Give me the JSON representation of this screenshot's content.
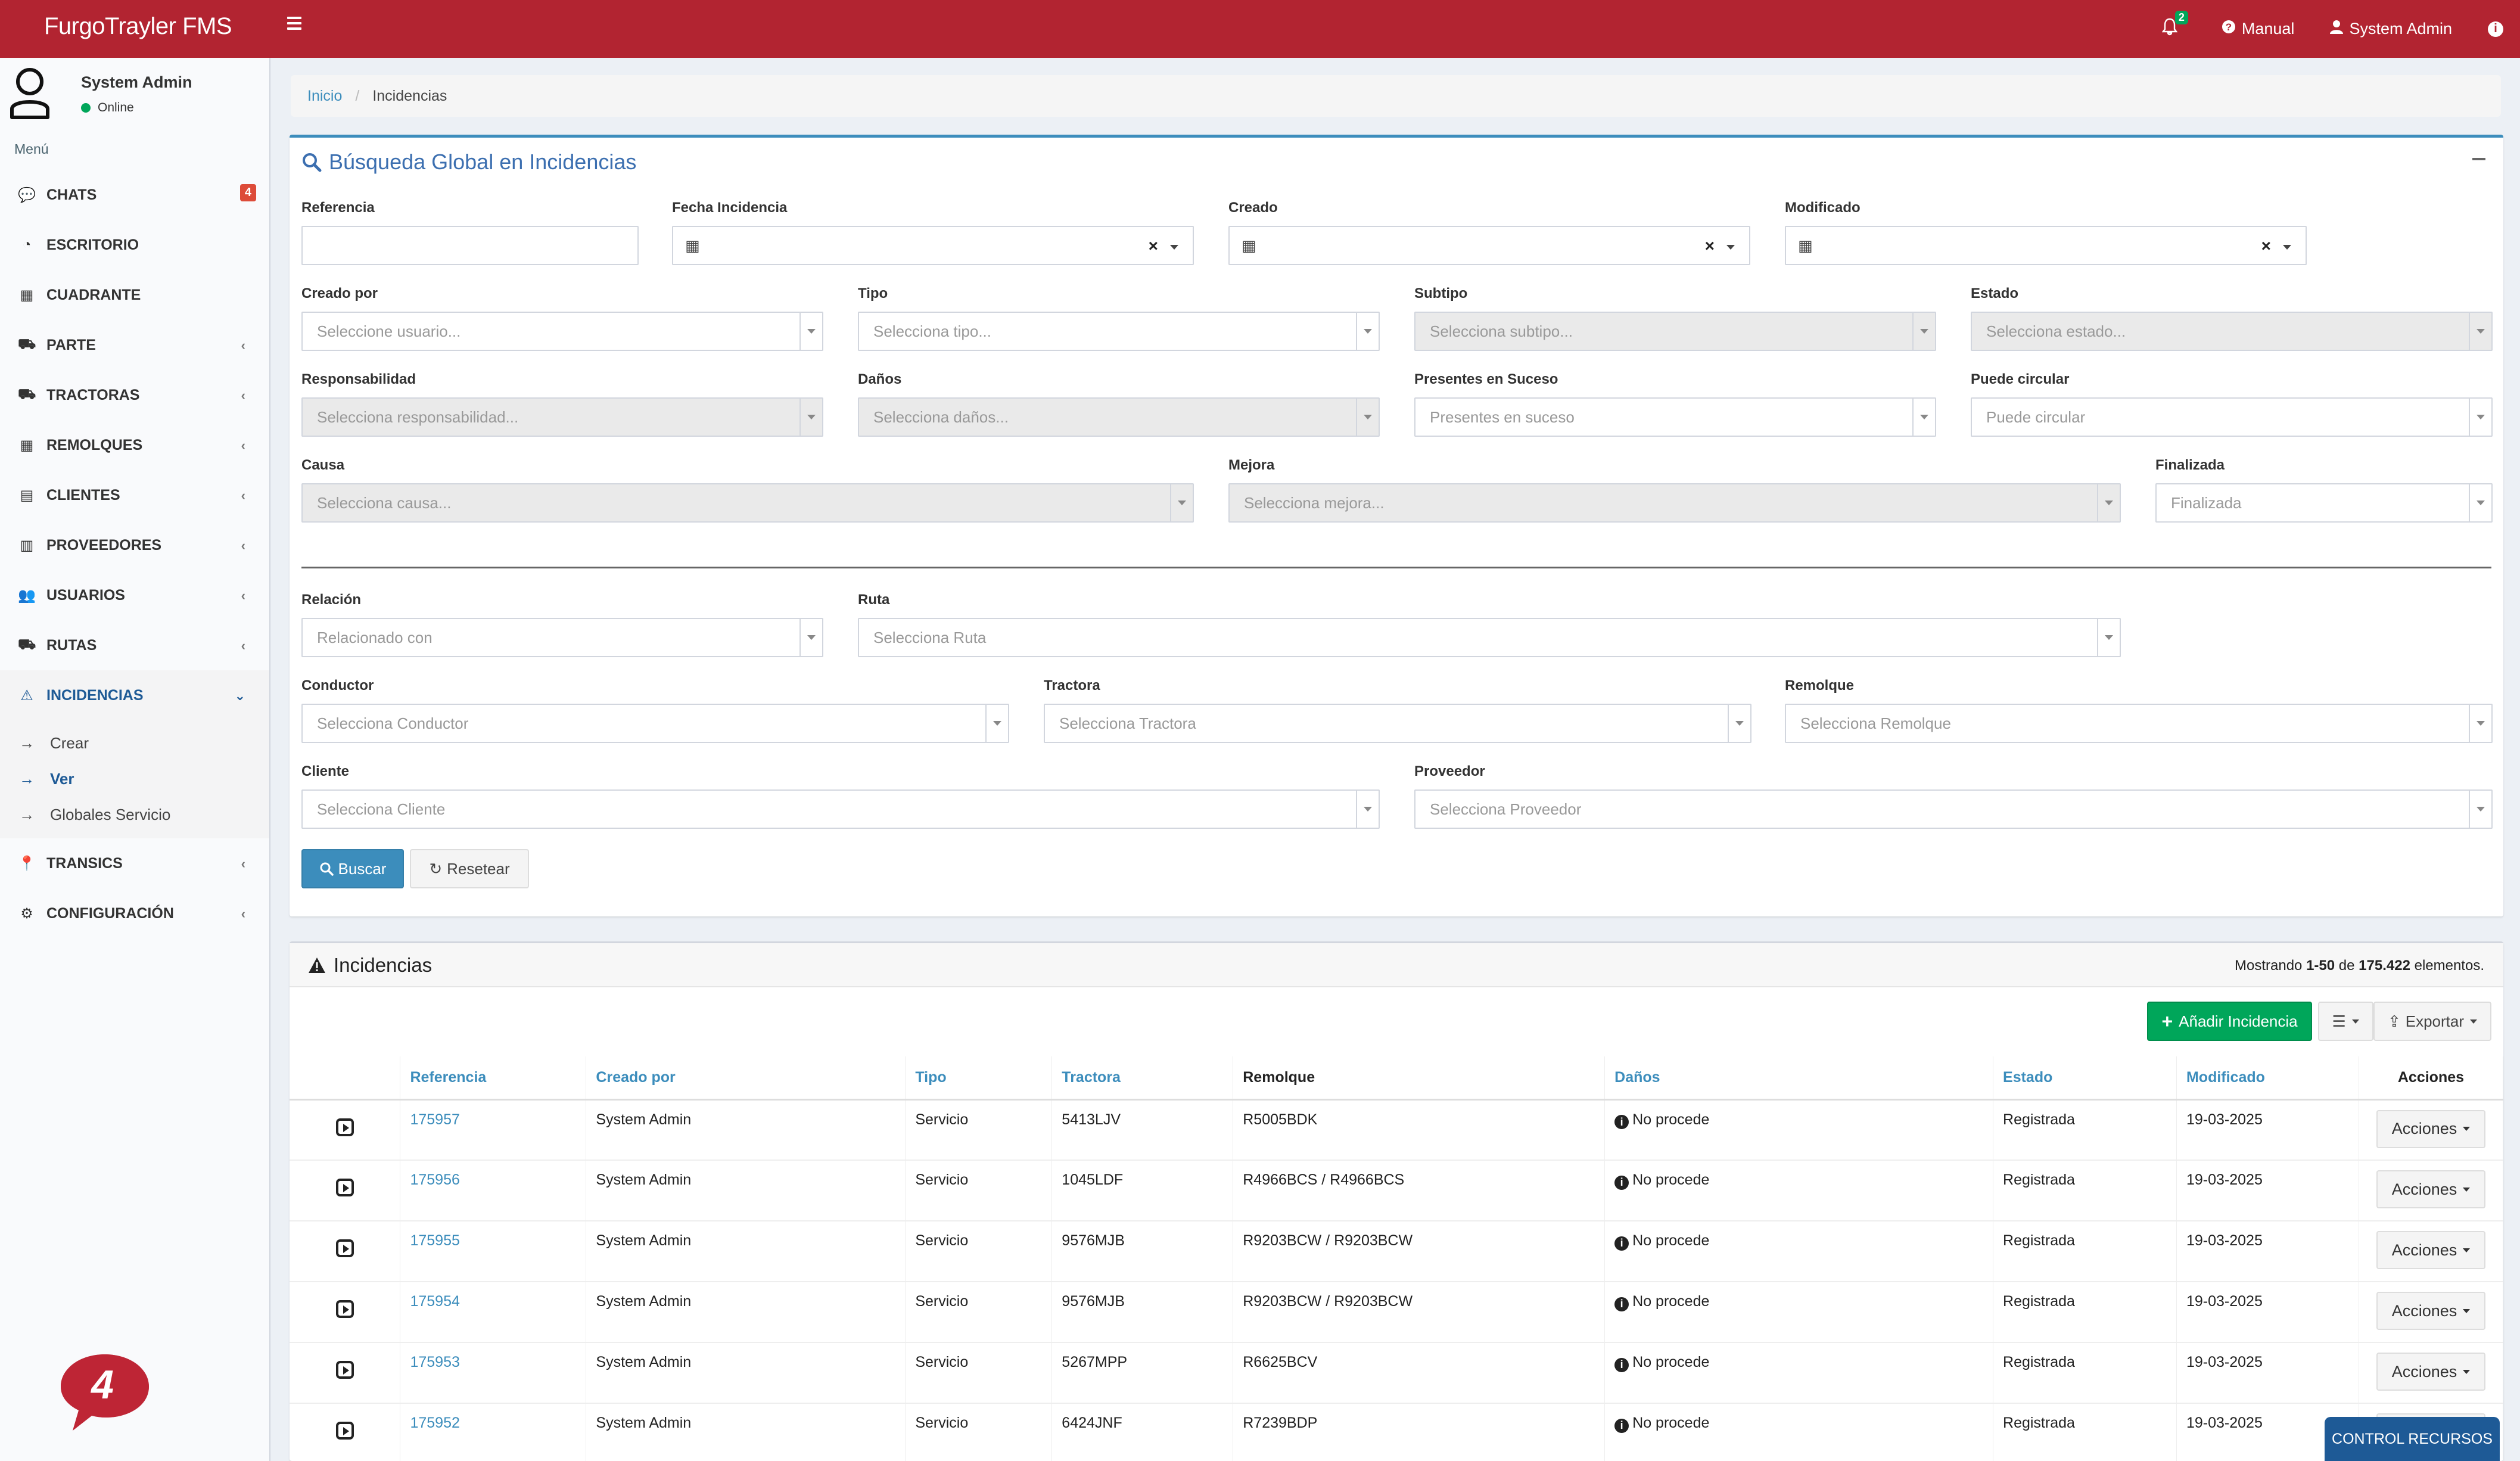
{
  "app": {
    "brand": "FurgoTrayler FMS",
    "notifications_count": "2",
    "manual_label": "Manual",
    "user_label": "System Admin"
  },
  "sidebar": {
    "user_name": "System Admin",
    "user_status": "Online",
    "menu_header": "Menú",
    "items": [
      {
        "label": "CHATS",
        "icon": "comments-icon",
        "badge": "4"
      },
      {
        "label": "ESCRITORIO",
        "icon": "dashboard-icon"
      },
      {
        "label": "CUADRANTE",
        "icon": "table-icon"
      },
      {
        "label": "PARTE",
        "icon": "road-icon"
      },
      {
        "label": "TRACTORAS",
        "icon": "truck-icon"
      },
      {
        "label": "REMOLQUES",
        "icon": "grid-icon"
      },
      {
        "label": "CLIENTES",
        "icon": "briefcase-icon"
      },
      {
        "label": "PROVEEDORES",
        "icon": "building-icon"
      },
      {
        "label": "USUARIOS",
        "icon": "users-icon"
      },
      {
        "label": "RUTAS",
        "icon": "road-icon"
      },
      {
        "label": "INCIDENCIAS",
        "icon": "warning-icon"
      },
      {
        "label": "TRANSICS",
        "icon": "map-marker-icon"
      },
      {
        "label": "CONFIGURACIÓN",
        "icon": "cogs-icon"
      }
    ],
    "incidencias_sub": [
      {
        "label": "Crear"
      },
      {
        "label": "Ver"
      },
      {
        "label": "Globales Servicio"
      }
    ],
    "chat_bubble_count": "4"
  },
  "breadcrumb": {
    "home": "Inicio",
    "current": "Incidencias"
  },
  "search": {
    "title": "Búsqueda Global en Incidencias",
    "fields": {
      "referencia": {
        "label": "Referencia",
        "value": ""
      },
      "fecha_incidencia": {
        "label": "Fecha Incidencia"
      },
      "creado": {
        "label": "Creado"
      },
      "modificado": {
        "label": "Modificado"
      },
      "creado_por": {
        "label": "Creado por",
        "placeholder": "Seleccione usuario..."
      },
      "tipo": {
        "label": "Tipo",
        "placeholder": "Selecciona tipo..."
      },
      "subtipo": {
        "label": "Subtipo",
        "placeholder": "Selecciona subtipo..."
      },
      "estado": {
        "label": "Estado",
        "placeholder": "Selecciona estado..."
      },
      "responsabilidad": {
        "label": "Responsabilidad",
        "placeholder": "Selecciona responsabilidad..."
      },
      "danos": {
        "label": "Daños",
        "placeholder": "Selecciona daños..."
      },
      "presentes": {
        "label": "Presentes en Suceso",
        "placeholder": "Presentes en suceso"
      },
      "puede_circular": {
        "label": "Puede circular",
        "placeholder": "Puede circular"
      },
      "causa": {
        "label": "Causa",
        "placeholder": "Selecciona causa..."
      },
      "mejora": {
        "label": "Mejora",
        "placeholder": "Selecciona mejora..."
      },
      "finalizada": {
        "label": "Finalizada",
        "placeholder": "Finalizada"
      },
      "relacion": {
        "label": "Relación",
        "placeholder": "Relacionado con"
      },
      "ruta": {
        "label": "Ruta",
        "placeholder": "Selecciona Ruta"
      },
      "conductor": {
        "label": "Conductor",
        "placeholder": "Selecciona Conductor"
      },
      "tractora": {
        "label": "Tractora",
        "placeholder": "Selecciona Tractora"
      },
      "remolque": {
        "label": "Remolque",
        "placeholder": "Selecciona Remolque"
      },
      "cliente": {
        "label": "Cliente",
        "placeholder": "Selecciona Cliente"
      },
      "proveedor": {
        "label": "Proveedor",
        "placeholder": "Selecciona Proveedor"
      }
    },
    "buscar_label": "Buscar",
    "resetear_label": "Resetear"
  },
  "results": {
    "title": "Incidencias",
    "summary_prefix": "Mostrando ",
    "summary_range": "1-50",
    "summary_mid": " de ",
    "summary_total": "175.422",
    "summary_suffix": " elementos.",
    "add_label": "Añadir Incidencia",
    "export_label": "Exportar",
    "columns": [
      "Referencia",
      "Creado por",
      "Tipo",
      "Tractora",
      "Remolque",
      "Daños",
      "Estado",
      "Modificado",
      "Acciones"
    ],
    "action_label": "Acciones",
    "rows": [
      {
        "ref": "175957",
        "creado_por": "System Admin",
        "tipo": "Servicio",
        "tractora": "5413LJV",
        "remolque": "R5005BDK",
        "danos": "No procede",
        "estado": "Registrada",
        "modificado": "19-03-2025"
      },
      {
        "ref": "175956",
        "creado_por": "System Admin",
        "tipo": "Servicio",
        "tractora": "1045LDF",
        "remolque": "R4966BCS / R4966BCS",
        "danos": "No procede",
        "estado": "Registrada",
        "modificado": "19-03-2025"
      },
      {
        "ref": "175955",
        "creado_por": "System Admin",
        "tipo": "Servicio",
        "tractora": "9576MJB",
        "remolque": "R9203BCW / R9203BCW",
        "danos": "No procede",
        "estado": "Registrada",
        "modificado": "19-03-2025"
      },
      {
        "ref": "175954",
        "creado_por": "System Admin",
        "tipo": "Servicio",
        "tractora": "9576MJB",
        "remolque": "R9203BCW / R9203BCW",
        "danos": "No procede",
        "estado": "Registrada",
        "modificado": "19-03-2025"
      },
      {
        "ref": "175953",
        "creado_por": "System Admin",
        "tipo": "Servicio",
        "tractora": "5267MPP",
        "remolque": "R6625BCV",
        "danos": "No procede",
        "estado": "Registrada",
        "modificado": "19-03-2025"
      },
      {
        "ref": "175952",
        "creado_por": "System Admin",
        "tipo": "Servicio",
        "tractora": "6424JNF",
        "remolque": "R7239BDP",
        "danos": "No procede",
        "estado": "Registrada",
        "modificado": "19-03-2025"
      }
    ]
  },
  "control_recursos_label": "CONTROL RECURSOS",
  "colors": {
    "topbar": "#b22431",
    "primary": "#3c8dbc",
    "success": "#00a65a",
    "sidebar_active": "#1e5a96"
  }
}
